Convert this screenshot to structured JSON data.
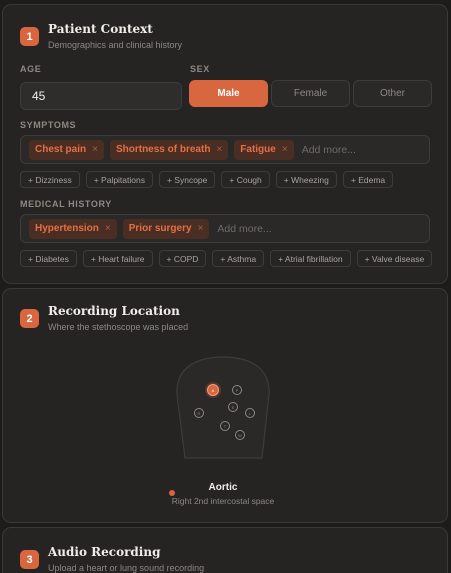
{
  "patient": {
    "step": "1",
    "title": "Patient Context",
    "subtitle": "Demographics and clinical history",
    "age_label": "AGE",
    "age_value": "45",
    "sex_label": "SEX",
    "sex_options": [
      "Male",
      "Female",
      "Other"
    ],
    "sex_selected": "Male",
    "symptoms_label": "SYMPTOMS",
    "symptoms_selected": [
      "Chest pain",
      "Shortness of breath",
      "Fatigue"
    ],
    "symptoms_placeholder": "Add more...",
    "symptoms_suggestions": [
      "+ Dizziness",
      "+ Palpitations",
      "+ Syncope",
      "+ Cough",
      "+ Wheezing",
      "+ Edema"
    ],
    "history_label": "MEDICAL HISTORY",
    "history_selected": [
      "Hypertension",
      "Prior surgery"
    ],
    "history_placeholder": "Add more...",
    "history_suggestions": [
      "+ Diabetes",
      "+ Heart failure",
      "+ COPD",
      "+ Asthma",
      "+ Atrial fibrillation",
      "+ Valve disease"
    ],
    "remove_glyph": "×"
  },
  "recording_location": {
    "step": "2",
    "title": "Recording Location",
    "subtitle": "Where the stethoscope was placed",
    "selected_name": "Aortic",
    "selected_desc": "Right 2nd intercostal space"
  },
  "audio": {
    "step": "3",
    "title": "Audio Recording",
    "subtitle": "Upload a heart or lung sound recording"
  },
  "colors": {
    "accent": "#d8663f",
    "card_bg": "#252423",
    "page_bg": "#1d1c1b"
  }
}
